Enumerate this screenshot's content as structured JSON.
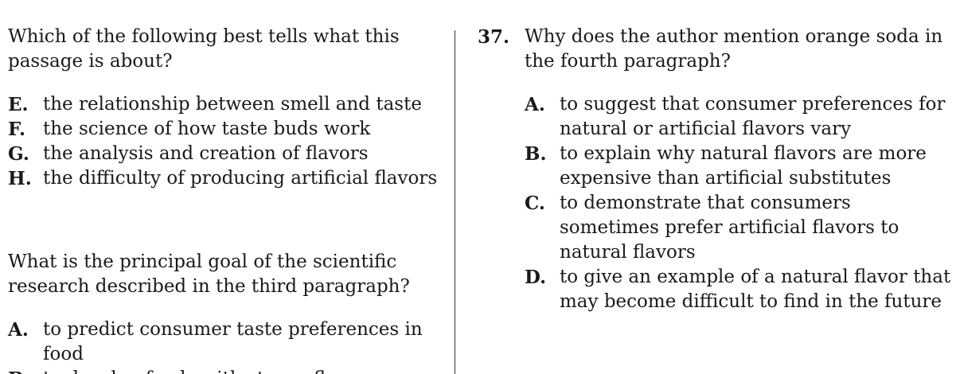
{
  "left_column": {
    "question_a": {
      "stem": "Which of the following best tells what this passage is about?",
      "choices": [
        {
          "letter": "E.",
          "text": "the relationship between smell and taste"
        },
        {
          "letter": "F.",
          "text": "the science of how taste buds work"
        },
        {
          "letter": "G.",
          "text": "the analysis and creation of flavors"
        },
        {
          "letter": "H.",
          "text": "the difficulty of producing artificial flavors"
        }
      ]
    },
    "question_b": {
      "stem": "What is the principal goal of the scientific research described in the third paragraph?",
      "choices": [
        {
          "letter": "A.",
          "text": "to predict consumer taste preferences in food"
        },
        {
          "letter": "B.",
          "text": "to develop foods with strong flavors"
        }
      ]
    }
  },
  "right_column": {
    "question": {
      "number": "37.",
      "stem": "Why does the author mention orange soda in the fourth paragraph?",
      "choices": [
        {
          "letter": "A.",
          "text": "to suggest that consumer preferences for natural or artificial flavors vary"
        },
        {
          "letter": "B.",
          "text": "to explain why natural flavors are more expensive than artificial substitutes"
        },
        {
          "letter": "C.",
          "text": "to demonstrate that consumers sometimes prefer artificial flavors to natural flavors"
        },
        {
          "letter": "D.",
          "text": "to give an example of a natural flavor that may become difficult to find in the future"
        }
      ]
    }
  }
}
